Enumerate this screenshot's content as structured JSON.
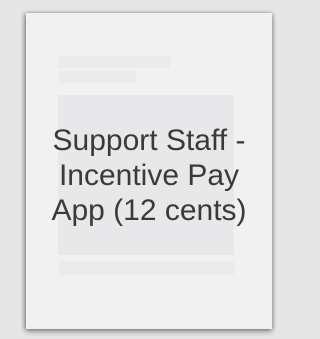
{
  "tile": {
    "label": "Support Staff - Incentive Pay App (12 cents)",
    "colors": {
      "page_bg": "#e6e6e6",
      "tile_bg": "#f1f1f1",
      "text": "#3a3a3a"
    }
  }
}
